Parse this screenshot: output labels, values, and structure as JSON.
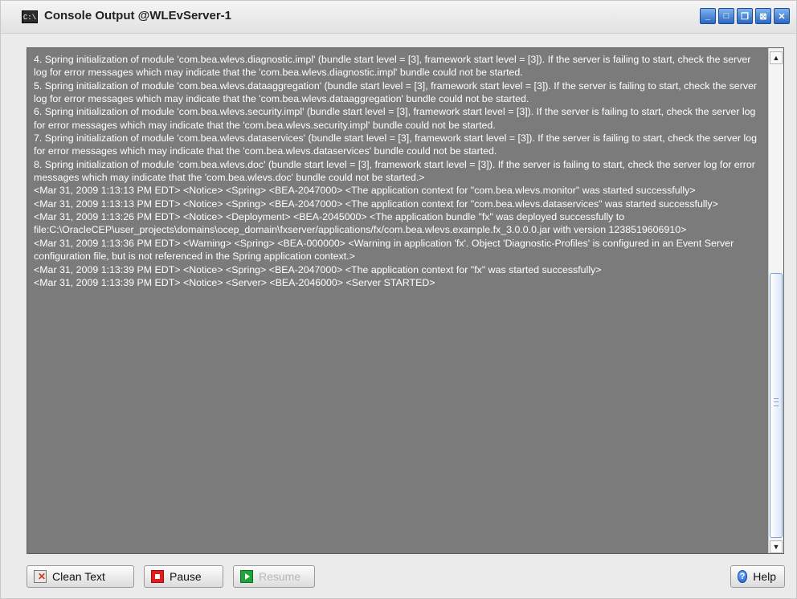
{
  "window": {
    "title": "Console Output @WLEvServer-1",
    "icon": "console-icon",
    "controls": [
      {
        "name": "minimize-icon",
        "glyph": "_"
      },
      {
        "name": "maximize-icon",
        "glyph": "□"
      },
      {
        "name": "restore-icon",
        "glyph": "❐"
      },
      {
        "name": "detach-icon",
        "glyph": "⊠"
      },
      {
        "name": "close-icon",
        "glyph": "✕"
      }
    ]
  },
  "console": {
    "lines": [
      "  4. Spring initialization of module 'com.bea.wlevs.diagnostic.impl' (bundle start level = [3], framework start level = [3]).  If the server is failing to start, check the server log for error messages which may indicate that the 'com.bea.wlevs.diagnostic.impl' bundle could not be started.",
      "  5. Spring initialization of module 'com.bea.wlevs.dataaggregation' (bundle start level = [3], framework start level = [3]).  If the server is failing to start, check the server log for error messages which may indicate that the 'com.bea.wlevs.dataaggregation' bundle could not be started.",
      "  6. Spring initialization of module 'com.bea.wlevs.security.impl' (bundle start level = [3], framework start level = [3]).  If the server is failing to start, check the server log for error messages which may indicate that the 'com.bea.wlevs.security.impl' bundle could not be started.",
      "  7. Spring initialization of module 'com.bea.wlevs.dataservices' (bundle start level = [3], framework start level = [3]).  If the server is failing to start, check the server log for error messages which may indicate that the 'com.bea.wlevs.dataservices' bundle could not be started.",
      "  8. Spring initialization of module 'com.bea.wlevs.doc' (bundle start level = [3], framework start level = [3]).  If the server is failing to start, check the server log for error messages which may indicate that the 'com.bea.wlevs.doc' bundle could not be started.>",
      "<Mar 31, 2009 1:13:13 PM EDT> <Notice> <Spring> <BEA-2047000> <The application context for \"com.bea.wlevs.monitor\" was started successfully>",
      "<Mar 31, 2009 1:13:13 PM EDT> <Notice> <Spring> <BEA-2047000> <The application context for \"com.bea.wlevs.dataservices\" was started successfully>",
      "<Mar 31, 2009 1:13:26 PM EDT> <Notice> <Deployment> <BEA-2045000> <The application bundle \"fx\" was deployed successfully to file:C:\\OracleCEP\\user_projects\\domains\\ocep_domain\\fxserver/applications/fx/com.bea.wlevs.example.fx_3.0.0.0.jar with version 1238519606910>",
      "<Mar 31, 2009 1:13:36 PM EDT> <Warning> <Spring> <BEA-000000> <Warning in application 'fx'.  Object 'Diagnostic-Profiles' is configured in an Event Server configuration file, but is not referenced in the Spring application context.>",
      "<Mar 31, 2009 1:13:39 PM EDT> <Notice> <Spring> <BEA-2047000> <The application context for \"fx\" was started successfully>",
      "<Mar 31, 2009 1:13:39 PM EDT> <Notice> <Server> <BEA-2046000> <Server STARTED>"
    ]
  },
  "toolbar": {
    "clean_label": "Clean Text",
    "pause_label": "Pause",
    "resume_label": "Resume",
    "help_label": "Help",
    "help_glyph": "?"
  },
  "scrollbar": {
    "up_glyph": "▲",
    "down_glyph": "▼"
  },
  "colors": {
    "console_bg": "#7b7b7b",
    "console_text": "#ffffff",
    "window_bg": "#ebebeb"
  }
}
